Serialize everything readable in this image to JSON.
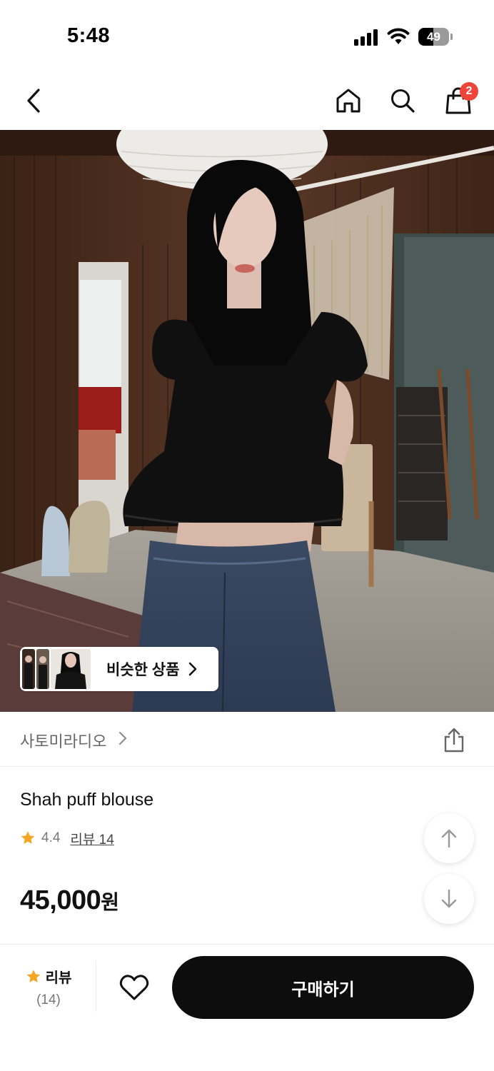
{
  "status_bar": {
    "time": "5:48",
    "battery": "49",
    "battery_level": 0.49
  },
  "nav": {
    "back_icon": "chevron-left-icon",
    "home_icon": "home-icon",
    "search_icon": "search-icon",
    "cart_icon": "shopping-bag-icon",
    "cart_count": "2"
  },
  "hero": {
    "similar_label": "비슷한 상품"
  },
  "brand": {
    "name": "사토미라디오",
    "share_icon": "share-icon"
  },
  "product": {
    "name": "Shah puff blouse",
    "rating": "4.4",
    "review_link": "리뷰 14",
    "price": "45,000",
    "price_unit": "원"
  },
  "bottom_bar": {
    "review_label": "리뷰",
    "review_count": "(14)",
    "buy_label": "구매하기"
  },
  "colors": {
    "accent": "#f5a524",
    "badge": "#f0443a",
    "buy_button": "#0d0d0d"
  }
}
